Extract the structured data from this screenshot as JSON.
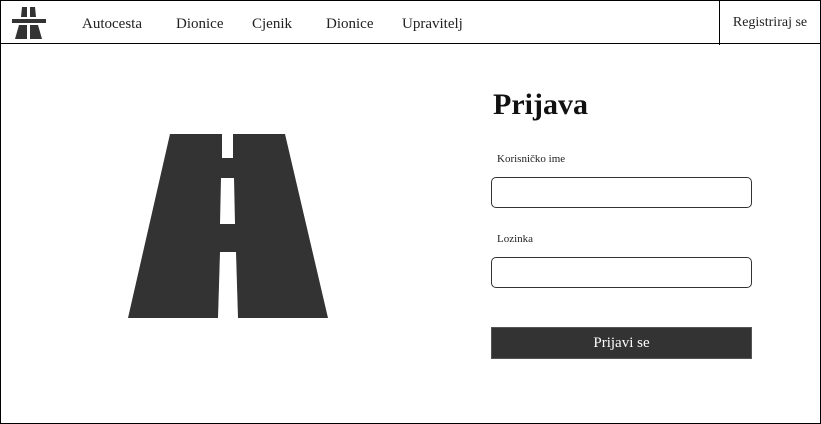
{
  "nav": {
    "items": [
      "Autocesta",
      "Dionice",
      "Cjenik",
      "Dionice",
      "Upravitelj"
    ],
    "register": "Registriraj se"
  },
  "login": {
    "title": "Prijava",
    "username_label": "Korisničko ime",
    "username_value": "",
    "password_label": "Lozinka",
    "password_value": "",
    "submit": "Prijavi se"
  },
  "colors": {
    "dark": "#333333"
  }
}
